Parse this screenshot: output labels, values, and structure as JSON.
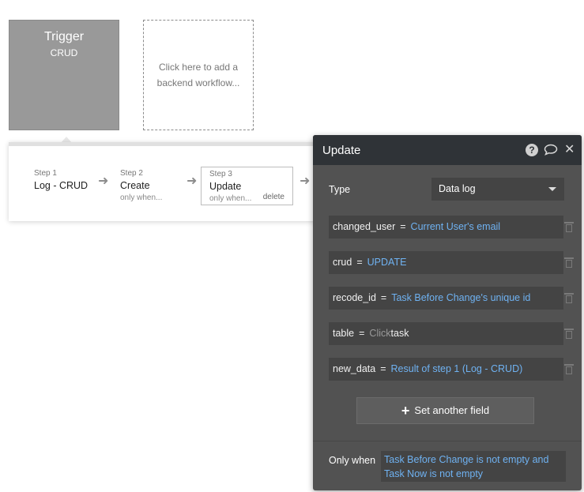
{
  "trigger": {
    "title": "Trigger",
    "subtitle": "CRUD"
  },
  "add_workflow": {
    "label": "Click here to add a backend workflow..."
  },
  "steps": [
    {
      "number": "Step 1",
      "name": "Log - CRUD"
    },
    {
      "number": "Step 2",
      "name": "Create",
      "condition": "only when..."
    },
    {
      "number": "Step 3",
      "name": "Update",
      "condition": "only when...",
      "delete_label": "delete"
    }
  ],
  "panel": {
    "title": "Update",
    "type_label": "Type",
    "type_value": "Data log",
    "fields": [
      {
        "name": "changed_user",
        "value": "Current User's email"
      },
      {
        "name": "crud",
        "value": "UPDATE"
      },
      {
        "name": "recode_id",
        "value": "Task Before Change's unique id"
      },
      {
        "name": "table",
        "placeholder": "Click",
        "plain": "task"
      },
      {
        "name": "new_data",
        "value": "Result of step 1 (Log - CRUD)"
      }
    ],
    "add_field_label": "Set another field",
    "only_when_label": "Only when",
    "only_when_value": "Task Before Change is not empty and Task Now is not empty"
  },
  "colors": {
    "panel_bg": "#525252",
    "header_bg": "#2f3337",
    "expression_blue": "#6fb2f2",
    "trigger_bg": "#999999"
  }
}
